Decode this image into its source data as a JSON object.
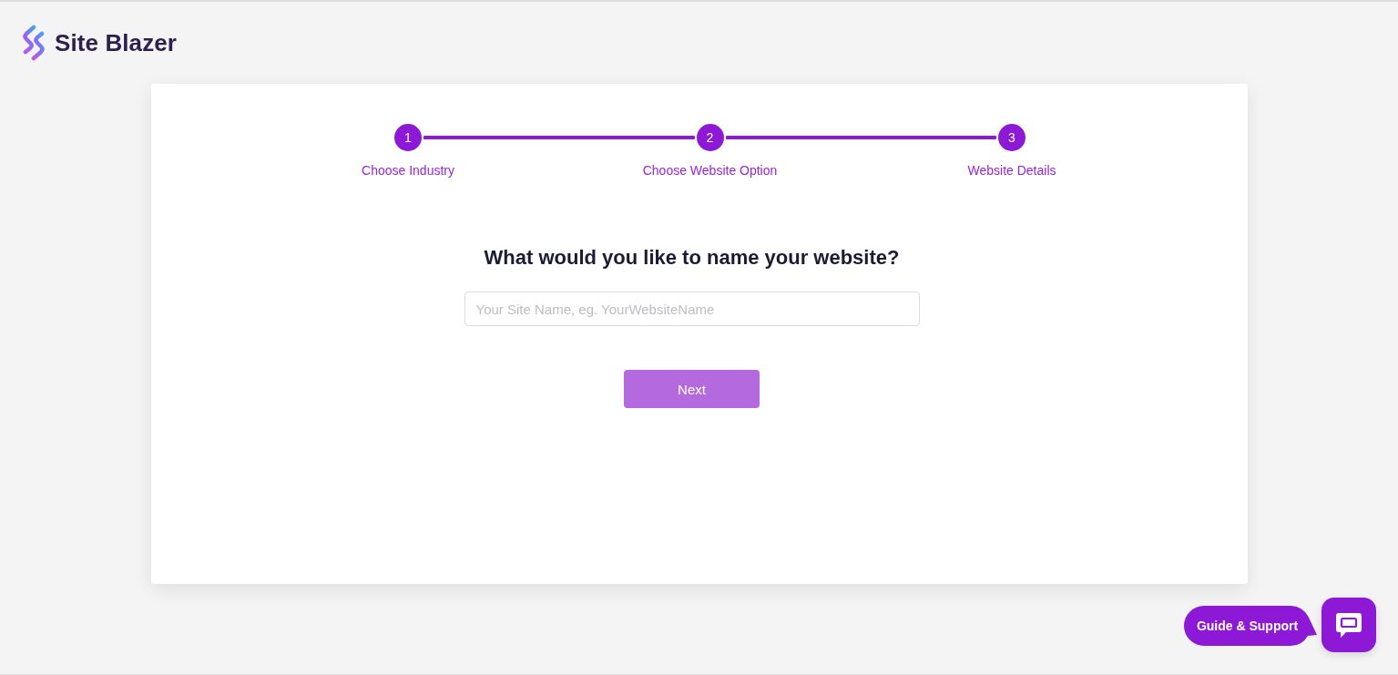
{
  "logo": {
    "name": "Site Blazer"
  },
  "steps": [
    {
      "number": "1",
      "label": "Choose Industry"
    },
    {
      "number": "2",
      "label": "Choose Website Option"
    },
    {
      "number": "3",
      "label": "Website Details"
    }
  ],
  "question": "What would you like to name your website?",
  "site_name_field": {
    "placeholder": "Your Site Name, eg. YourWebsiteName"
  },
  "next_button": {
    "label": "Next",
    "disabled": true
  },
  "support": {
    "label": "Guide & Support"
  }
}
